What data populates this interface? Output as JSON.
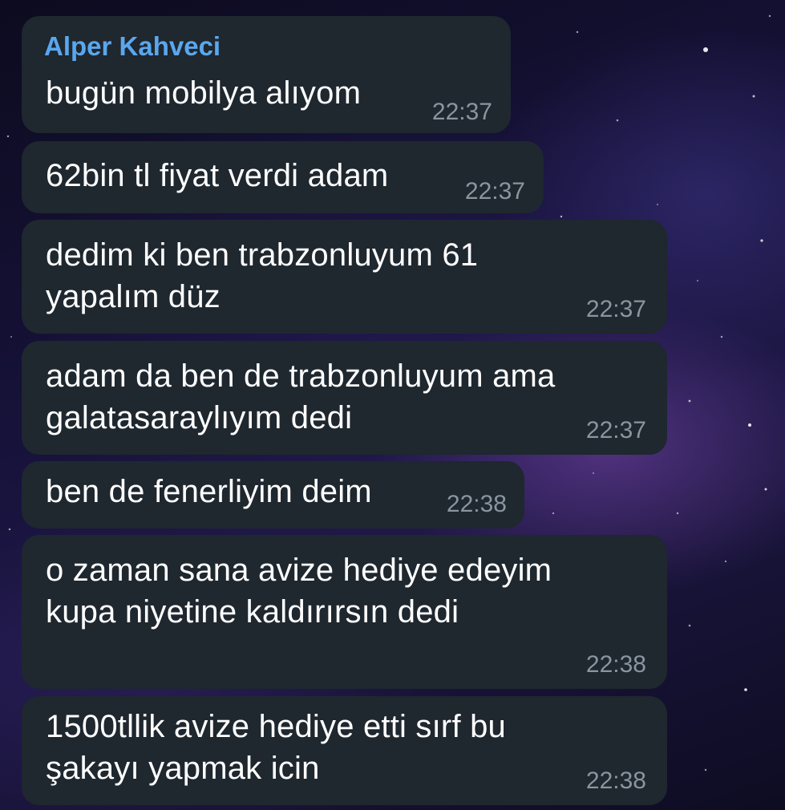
{
  "chat": {
    "sender_name": "Alper Kahveci",
    "messages": [
      {
        "text": "bugün mobilya alıyom",
        "time": "22:37"
      },
      {
        "text": "62bin tl fiyat verdi adam",
        "time": "22:37"
      },
      {
        "text": "dedim ki ben trabzonluyum 61\nyapalım düz",
        "time": "22:37"
      },
      {
        "text": "adam da ben de trabzonluyum ama\ngalatasaraylıyım dedi",
        "time": "22:37"
      },
      {
        "text": "ben de fenerliyim deim",
        "time": "22:38"
      },
      {
        "text": "o zaman sana avize hediye edeyim\nkupa niyetine kaldırırsın dedi",
        "time": "22:38"
      },
      {
        "text": "1500tllik avize hediye etti sırf bu\nşakayı yapmak icin",
        "time": "22:38"
      }
    ]
  },
  "colors": {
    "bubble": "#1f272f",
    "sender_name": "#5aa7ee",
    "timestamp": "#8a959f",
    "message_text": "#ffffff"
  }
}
